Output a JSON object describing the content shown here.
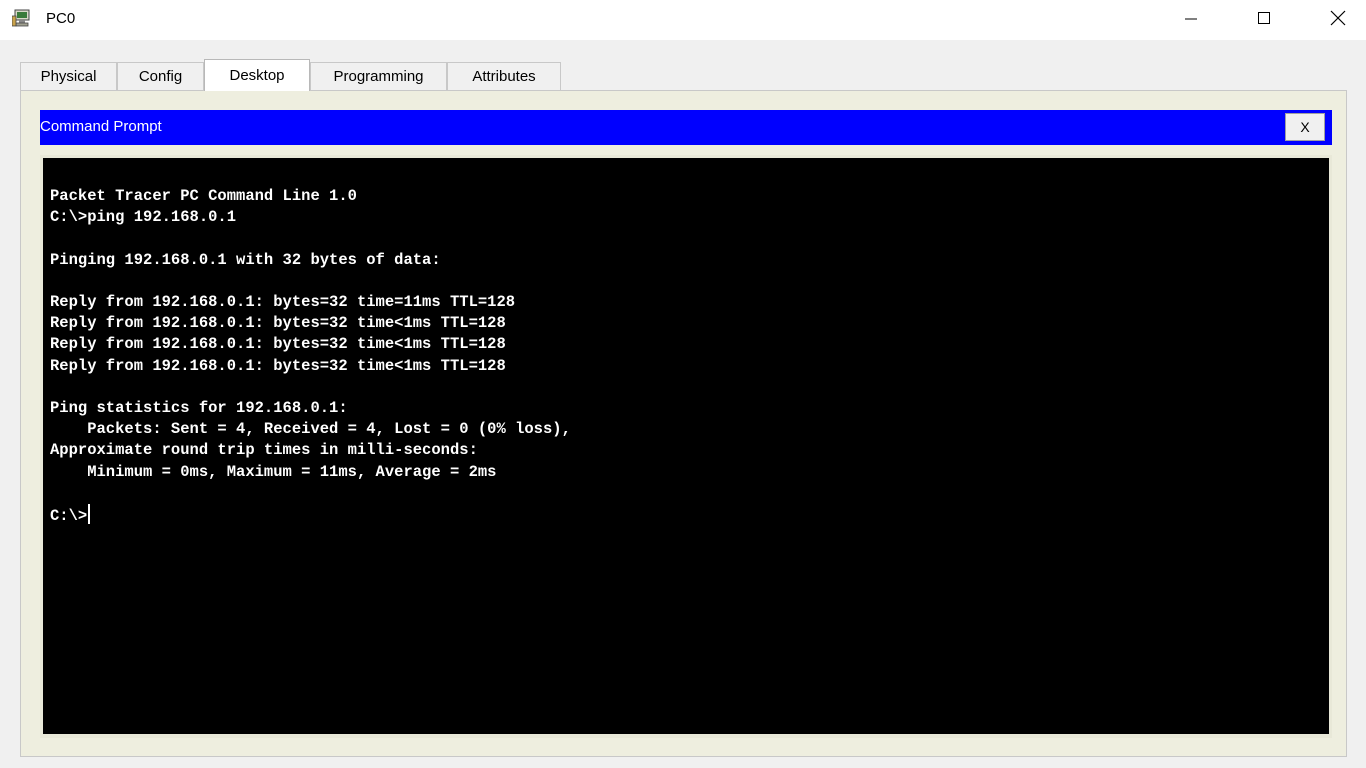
{
  "window": {
    "title": "PC0",
    "controls": [
      "minimize-icon",
      "maximize-icon",
      "close-icon"
    ]
  },
  "tabs": [
    {
      "label": "Physical",
      "active": false
    },
    {
      "label": "Config",
      "active": false
    },
    {
      "label": "Desktop",
      "active": true
    },
    {
      "label": "Programming",
      "active": false
    },
    {
      "label": "Attributes",
      "active": false
    }
  ],
  "command_prompt": {
    "title": "Command Prompt",
    "close_label": "X",
    "header_color": "#0000ff",
    "lines": [
      "Packet Tracer PC Command Line 1.0",
      "C:\\>ping 192.168.0.1",
      "",
      "Pinging 192.168.0.1 with 32 bytes of data:",
      "",
      "Reply from 192.168.0.1: bytes=32 time=11ms TTL=128",
      "Reply from 192.168.0.1: bytes=32 time<1ms TTL=128",
      "Reply from 192.168.0.1: bytes=32 time<1ms TTL=128",
      "Reply from 192.168.0.1: bytes=32 time<1ms TTL=128",
      "",
      "Ping statistics for 192.168.0.1:",
      "    Packets: Sent = 4, Received = 4, Lost = 0 (0% loss),",
      "Approximate round trip times in milli-seconds:",
      "    Minimum = 0ms, Maximum = 11ms, Average = 2ms",
      ""
    ],
    "prompt": "C:\\>"
  }
}
